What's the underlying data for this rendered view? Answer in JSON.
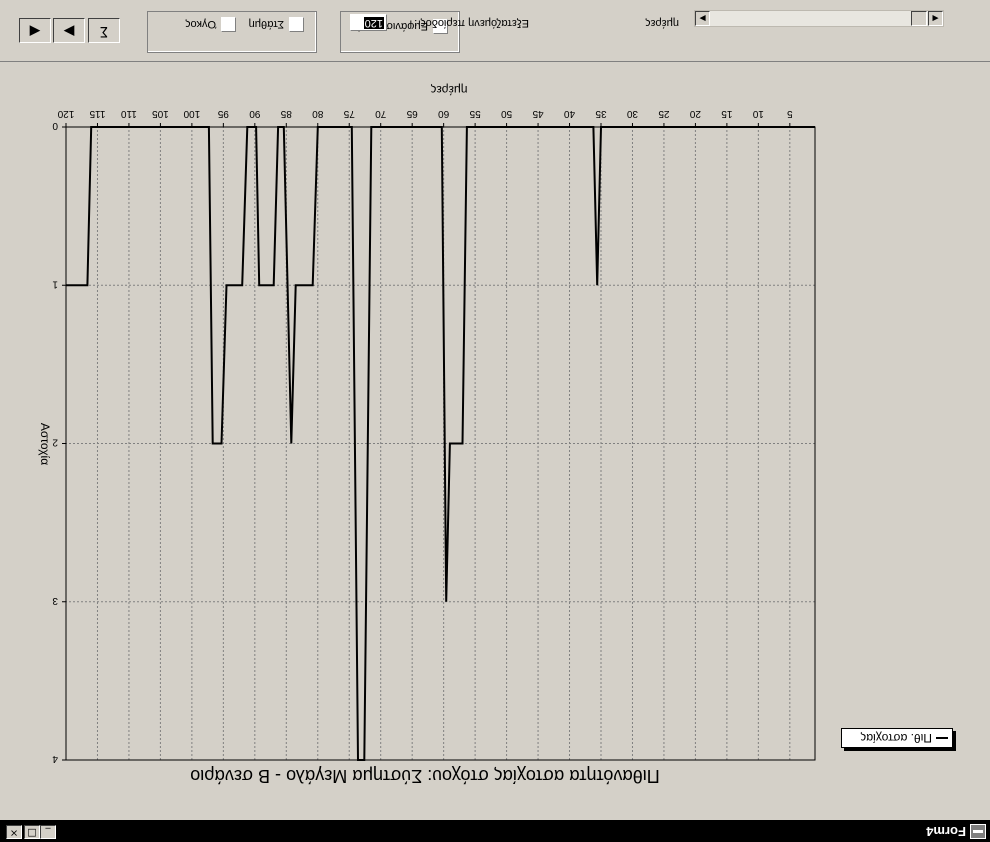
{
  "window": {
    "title": "Form4",
    "minimize_glyph": "_",
    "maximize_glyph": "□",
    "close_glyph": "×",
    "icon": "app-window-icon"
  },
  "toolbar": {
    "prev_glyph": "◀",
    "next_glyph": "▶",
    "sum_glyph": "Σ",
    "checkbox_stathmi": "Στάθμη",
    "checkbox_ogkos": "Όγκος",
    "checkbox_show_values": "Εμφάνιση τιμών",
    "period_label": "Εξεταζόμενη περίοδος :",
    "period_value": "120",
    "period_unit": "ημέρες",
    "scroll_left_glyph": "◀",
    "scroll_right_glyph": "▶"
  },
  "colors": {
    "window_bg": "#d4d0c8",
    "plot_bg": "#d4d0c8",
    "series": "#000000",
    "grid": "#808080"
  },
  "chart_data": {
    "type": "line",
    "title": "Πιθανότητα αστοχίας στόχου: Σύστημα Μεγάλο - Β σενάριο",
    "xlabel": "ημέρες",
    "ylabel": "Αστοχία",
    "xlim": [
      1,
      120
    ],
    "ylim": [
      0,
      4
    ],
    "xticks": [
      5,
      10,
      15,
      20,
      25,
      30,
      35,
      40,
      45,
      50,
      55,
      60,
      65,
      70,
      75,
      80,
      85,
      90,
      95,
      100,
      105,
      110,
      115,
      120
    ],
    "yticks": [
      0,
      1,
      2,
      3,
      4
    ],
    "grid": true,
    "legend_position": "right",
    "series": [
      {
        "name": "Πιθ. αστοχίας",
        "x": [
          1,
          35,
          35.6,
          36.2,
          37,
          56.3,
          57,
          59,
          59.6,
          60.3,
          62,
          71.5,
          72.6,
          73.6,
          74.6,
          80,
          80.8,
          83.5,
          84.2,
          85.4,
          86.3,
          87,
          89.3,
          89.8,
          90.6,
          91.2,
          92,
          94.5,
          95.3,
          96.7,
          97.3,
          99.8,
          116,
          116.6,
          120
        ],
        "values": [
          0,
          0,
          1,
          0,
          0,
          0,
          2,
          2,
          3,
          0,
          0,
          0,
          4,
          4,
          0,
          0,
          1,
          1,
          2,
          0,
          0,
          1,
          1,
          0,
          0,
          0,
          1,
          1,
          2,
          2,
          0,
          0,
          0,
          1,
          1
        ]
      }
    ]
  }
}
